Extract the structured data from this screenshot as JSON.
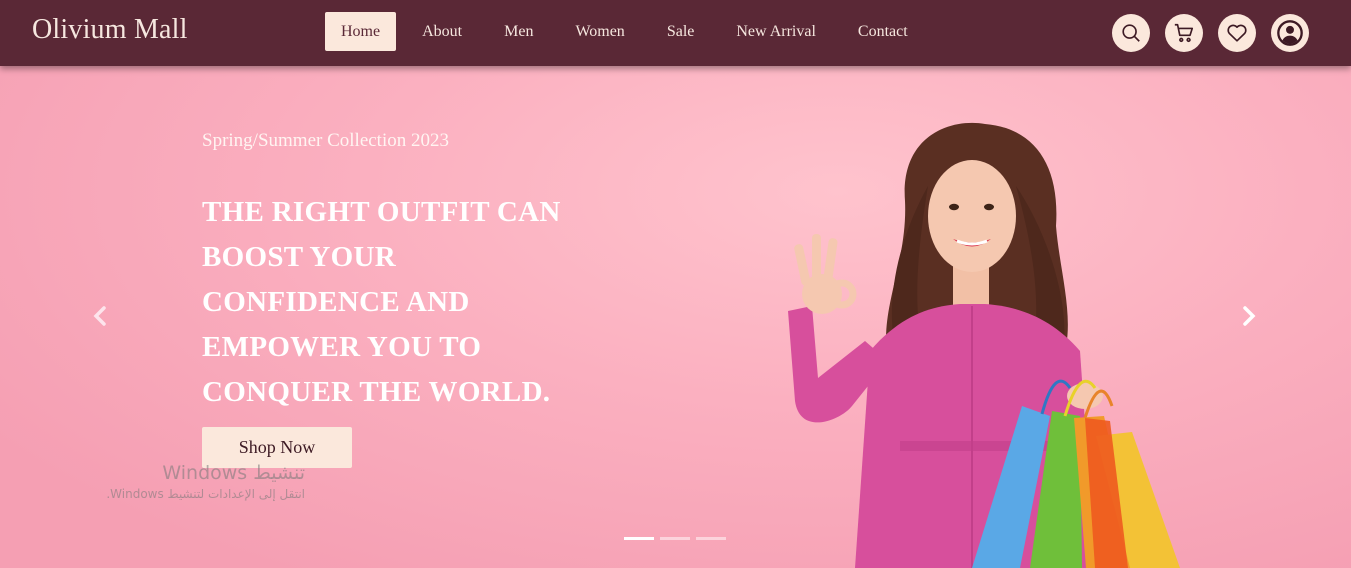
{
  "brand": "Olivium Mall",
  "nav": {
    "links": [
      {
        "label": "Home",
        "active": true
      },
      {
        "label": "About"
      },
      {
        "label": "Men"
      },
      {
        "label": "Women"
      },
      {
        "label": "Sale"
      },
      {
        "label": "New Arrival"
      },
      {
        "label": "Contact"
      }
    ],
    "icons": [
      "search-icon",
      "cart-icon",
      "heart-icon",
      "account-icon"
    ]
  },
  "hero": {
    "subtitle": "Spring/Summer Collection 2023",
    "headline_lines": [
      "THE RIGHT OUTFIT CAN",
      "BOOST YOUR",
      "CONFIDENCE AND",
      "EMPOWER YOU TO",
      "CONQUER THE WORLD."
    ],
    "button": "Shop Now",
    "slides_count": 3,
    "active_slide": 1
  },
  "watermark": {
    "title": "تنشيط Windows",
    "subtitle": "انتقل إلى الإعدادات لتنشيط Windows."
  },
  "colors": {
    "navbar": "#5a2836",
    "accent": "#fbe8dc",
    "hero_bg": "#f7a4b5",
    "text_light": "#ffffff"
  }
}
